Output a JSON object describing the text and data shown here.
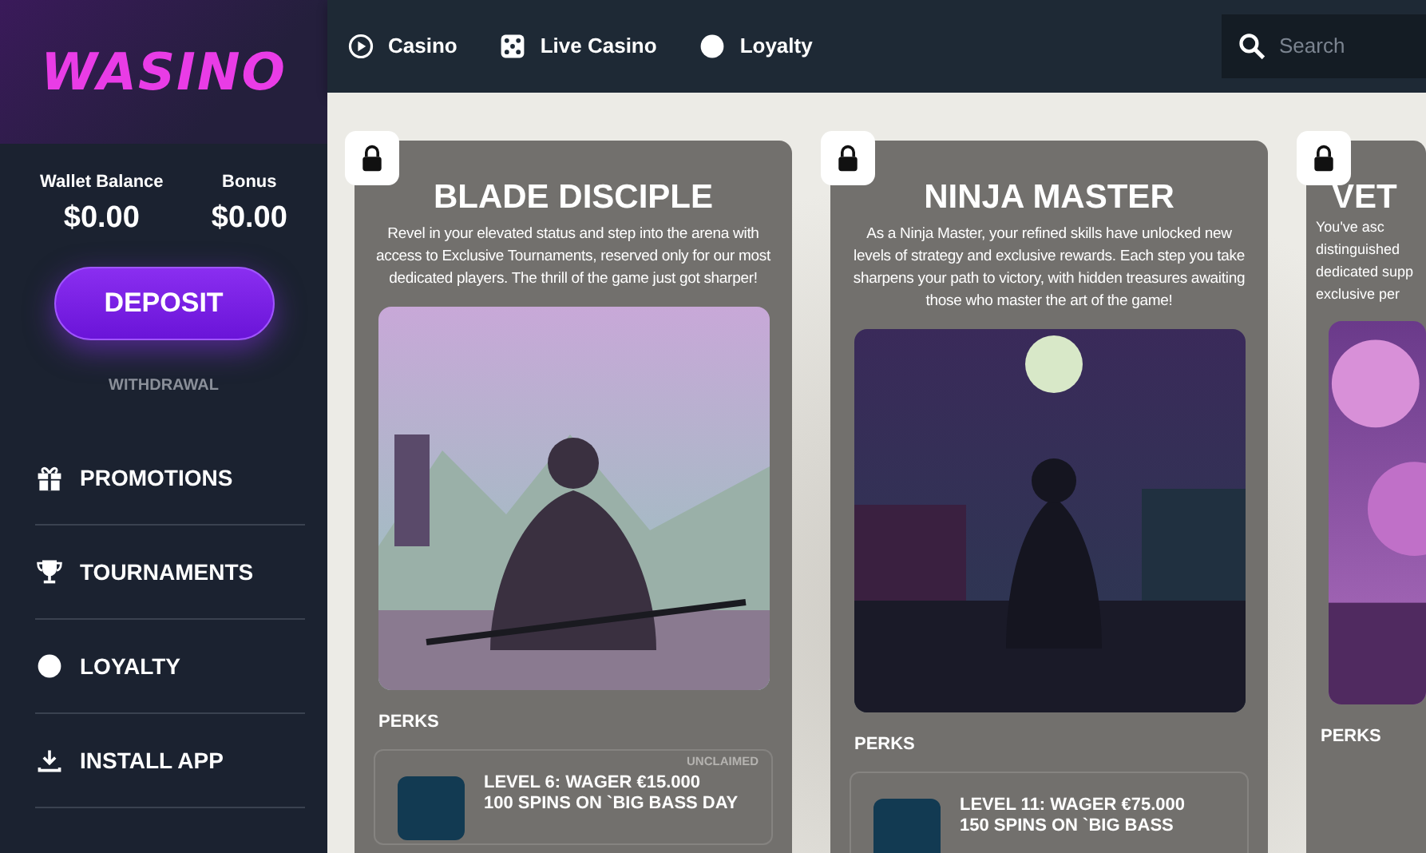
{
  "logo": {
    "text": "WASINO"
  },
  "wallet": [
    {
      "label": "Wallet Balance",
      "amount": "$0.00"
    },
    {
      "label": "Bonus",
      "amount": "$0.00"
    }
  ],
  "deposit_button": "DEPOSIT",
  "withdrawal_link": "WITHDRAWAL",
  "sidebar": {
    "items": [
      {
        "label": "PROMOTIONS"
      },
      {
        "label": "TOURNAMENTS"
      },
      {
        "label": "LOYALTY"
      },
      {
        "label": "INSTALL APP"
      }
    ]
  },
  "nav": [
    {
      "label": "Casino"
    },
    {
      "label": "Live Casino"
    },
    {
      "label": "Loyalty"
    }
  ],
  "search": {
    "placeholder": "Search"
  },
  "cards": [
    {
      "kind": "full",
      "locked": true,
      "title": "BLADE DISCIPLE",
      "description": "Revel in your elevated status and step into the arena with access to Exclusive Tournaments, reserved only for our most dedicated players. The thrill of the game just got sharper!",
      "perks_label": "PERKS",
      "perks": [
        {
          "title": "LEVEL 6: WAGER €15.000",
          "subtitle": "100 SPINS ON `BIG BASS DAY",
          "status": "UNCLAIMED"
        }
      ]
    },
    {
      "kind": "full",
      "locked": true,
      "title": "NINJA MASTER",
      "description": "As a Ninja Master, your refined skills have unlocked new levels of strategy and exclusive rewards. Each step you take sharpens your path to victory, with hidden treasures awaiting those who master the art of the game!",
      "perks_label": "PERKS",
      "perks": [
        {
          "title": "LEVEL 11: WAGER €75.000",
          "subtitle": "150 SPINS ON `BIG BASS"
        }
      ]
    },
    {
      "kind": "cut",
      "locked": true,
      "title": "VET",
      "description_lines": [
        "You've asc",
        "distinguished",
        "dedicated supp",
        "exclusive per"
      ],
      "perks_label": "PERKS"
    }
  ]
}
